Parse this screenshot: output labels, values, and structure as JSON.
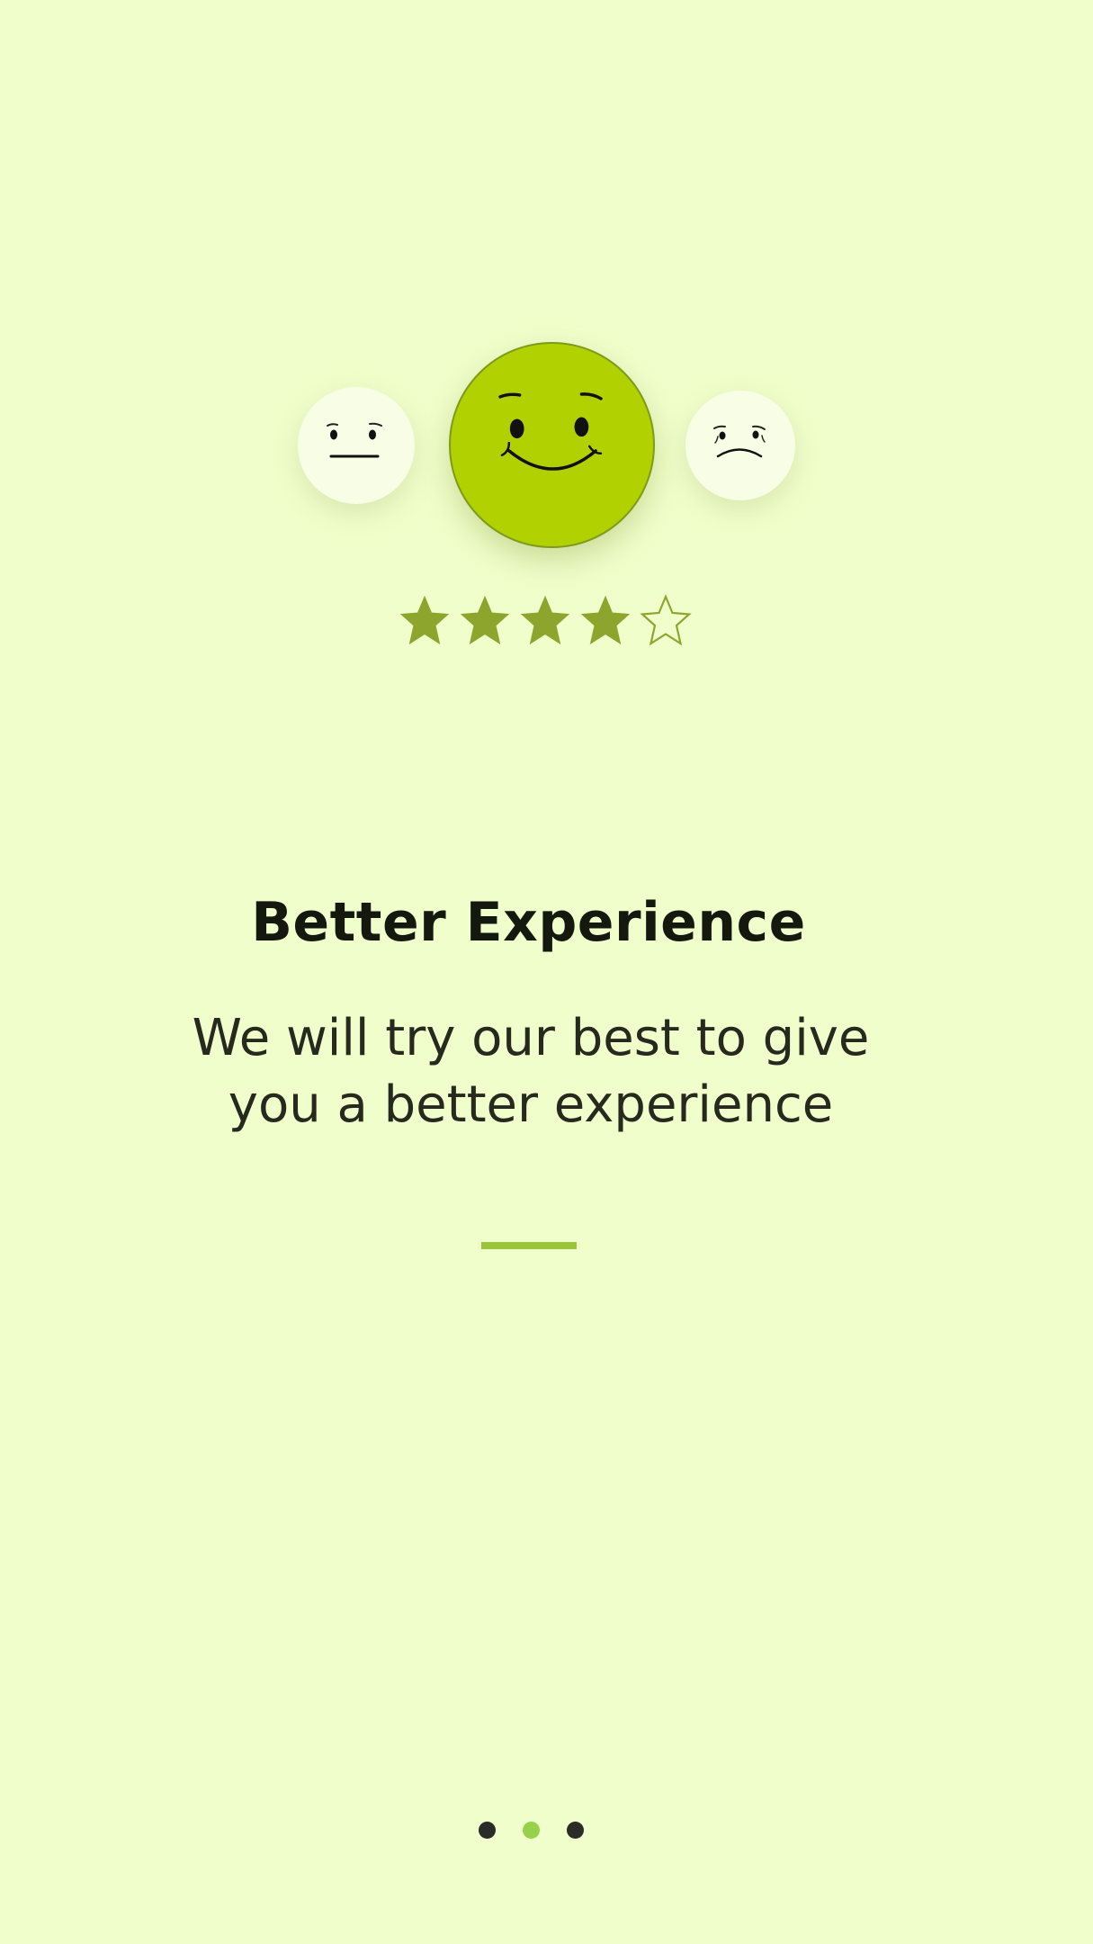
{
  "onboarding": {
    "title": "Better Experience",
    "description_lines": [
      "We will try our best to give",
      "you a better experience"
    ]
  },
  "emojis": [
    {
      "icon": "neutral-face-icon",
      "selected": false
    },
    {
      "icon": "smiling-face-icon",
      "selected": true
    },
    {
      "icon": "sad-face-icon",
      "selected": false
    }
  ],
  "rating": {
    "value": 4,
    "max": 5
  },
  "pagination": {
    "total": 3,
    "current": 2
  },
  "colors": {
    "background": "#f0fecb",
    "accent": "#b2d100",
    "star": "#8da52c",
    "divider": "#9ac43a",
    "active_dot": "#97d14a",
    "inactive_dot": "#2b2c28"
  }
}
